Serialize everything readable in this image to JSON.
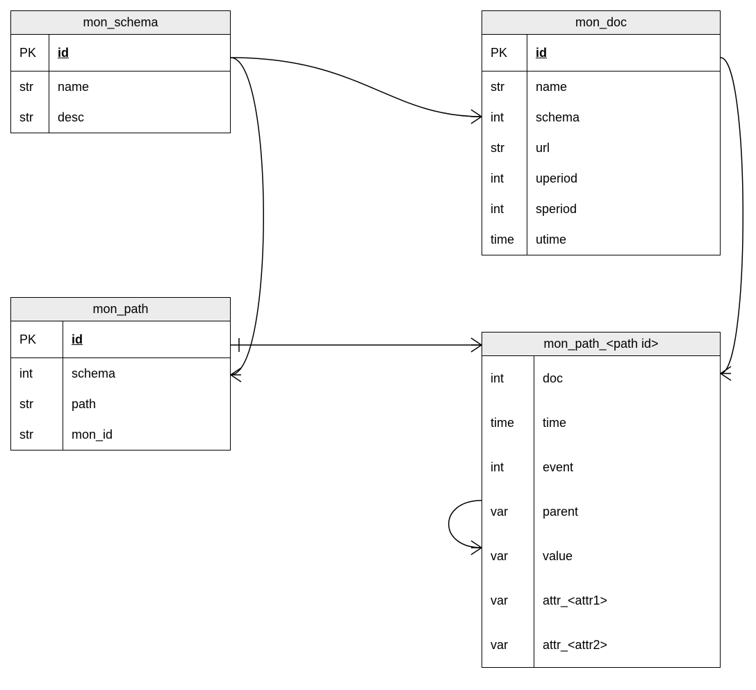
{
  "entities": {
    "mon_schema": {
      "title": "mon_schema",
      "pk_type": "PK",
      "pk_name": "id",
      "rows": [
        {
          "type": "str",
          "name": "name"
        },
        {
          "type": "str",
          "name": "desc"
        }
      ]
    },
    "mon_doc": {
      "title": "mon_doc",
      "pk_type": "PK",
      "pk_name": "id",
      "rows": [
        {
          "type": "str",
          "name": "name"
        },
        {
          "type": "int",
          "name": "schema"
        },
        {
          "type": "str",
          "name": "url"
        },
        {
          "type": "int",
          "name": "uperiod"
        },
        {
          "type": "int",
          "name": "speriod"
        },
        {
          "type": "time",
          "name": "utime"
        }
      ]
    },
    "mon_path": {
      "title": "mon_path",
      "pk_type": "PK",
      "pk_name": "id",
      "rows": [
        {
          "type": "int",
          "name": "schema"
        },
        {
          "type": "str",
          "name": "path"
        },
        {
          "type": "str",
          "name": "mon_id"
        }
      ]
    },
    "mon_path_id": {
      "title": "mon_path_<path id>",
      "rows": [
        {
          "type": "int",
          "name": "doc"
        },
        {
          "type": "time",
          "name": "time"
        },
        {
          "type": "int",
          "name": "event"
        },
        {
          "type": "var",
          "name": "parent"
        },
        {
          "type": "var",
          "name": "value"
        },
        {
          "type": "var",
          "name": "attr_<attr1>"
        },
        {
          "type": "var",
          "name": "attr_<attr2>"
        }
      ]
    }
  }
}
